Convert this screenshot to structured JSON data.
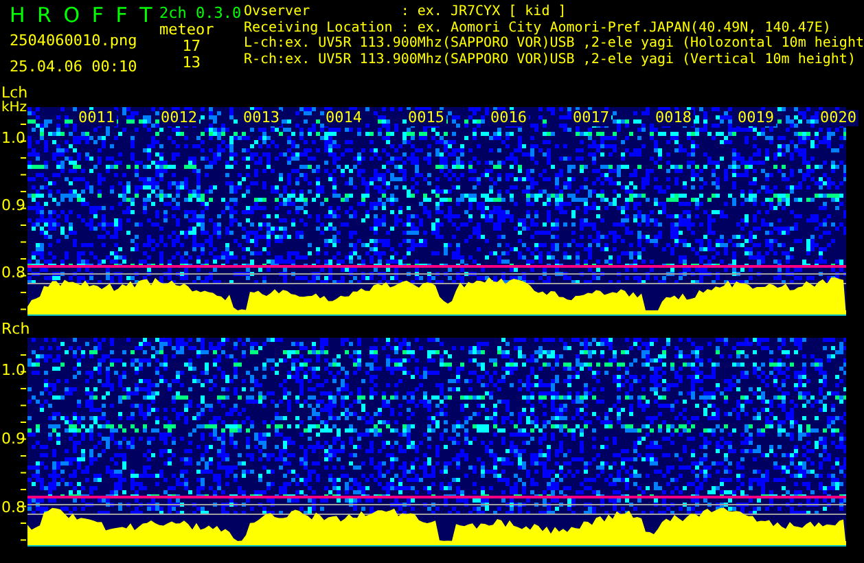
{
  "header": {
    "title": "H R O F F T",
    "version": "2ch 0.3.0",
    "filename": "2504060010.png",
    "datetime": "25.04.06 00:10",
    "mode": "meteor",
    "counts": [
      "17",
      "13"
    ],
    "info": [
      "Ovserver           : ex. JR7CYX [ kid ]",
      "Receiving Location : ex. Aomori City Aomori-Pref.JAPAN(40.49N, 140.47E)",
      "L-ch:ex. UV5R 113.900Mhz(SAPPORO VOR)USB ,2-ele yagi (Holozontal 10m height",
      "R-ch:ex. UV5R 113.900Mhz(SAPPORO VOR)USB ,2-ele yagi (Vertical 10m height)"
    ]
  },
  "channels": [
    {
      "label": "Lch",
      "unit": "kHz",
      "time_labels": [
        "0011",
        "0012",
        "0013",
        "0014",
        "0015",
        "0016",
        "0017",
        "0018",
        "0019",
        "0020"
      ],
      "freq_labels": [
        "1.0",
        "0.9",
        "0.8"
      ]
    },
    {
      "label": "Rch",
      "freq_labels": [
        "1.0",
        "0.9",
        "0.8"
      ]
    }
  ]
}
